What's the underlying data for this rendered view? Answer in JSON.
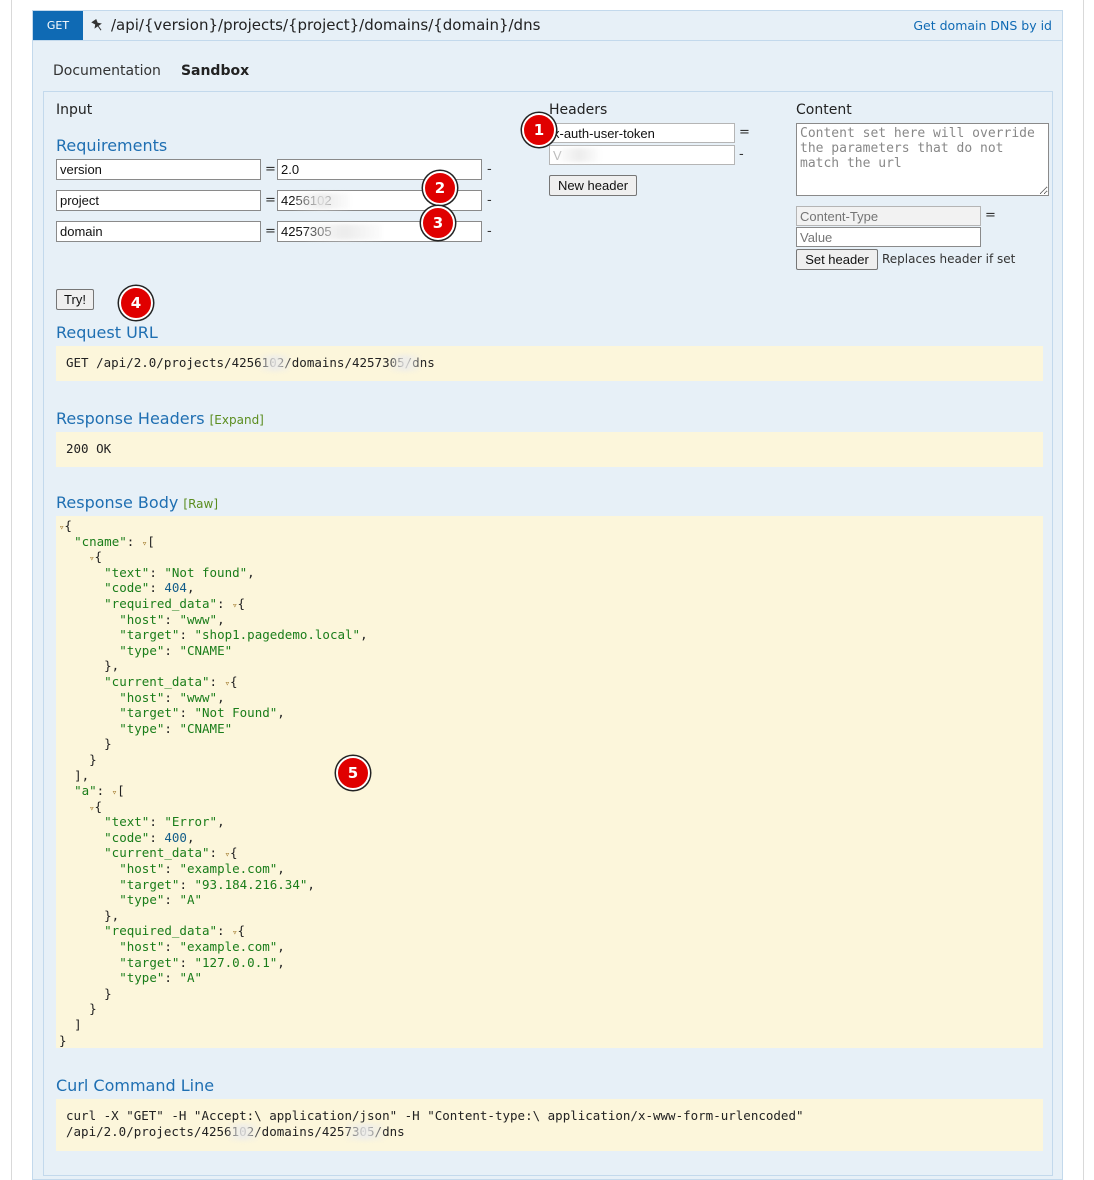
{
  "endpoint": {
    "method": "GET",
    "path": "/api/{version}/projects/{project}/domains/{domain}/dns",
    "summary": "Get domain DNS by id",
    "pin_icon": "pin-icon"
  },
  "tabs": [
    {
      "label": "Documentation",
      "active": false
    },
    {
      "label": "Sandbox",
      "active": true
    }
  ],
  "input": {
    "title": "Input",
    "requirements_title": "Requirements",
    "params": [
      {
        "name": "version",
        "value": "2.0"
      },
      {
        "name": "project",
        "value": "4256102"
      },
      {
        "name": "domain",
        "value": "4257305"
      }
    ],
    "try_label": "Try!"
  },
  "headers": {
    "title": "Headers",
    "name_value": "x-auth-user-token",
    "value_value": "V",
    "new_header_label": "New header"
  },
  "content": {
    "title": "Content",
    "placeholder": "Content set here will override the parameters that do not match the url",
    "content_type_placeholder": "Content-Type",
    "value_placeholder": "Value",
    "set_header_label": "Set header",
    "replaces_note": "Replaces header if set"
  },
  "request_url": {
    "title": "Request URL",
    "text": "GET /api/2.0/projects/4256102/domains/4257305/dns"
  },
  "response_headers": {
    "title": "Response Headers",
    "expand_label": "[Expand]",
    "text": "200 OK"
  },
  "response_body": {
    "title": "Response Body",
    "raw_label": "[Raw]",
    "lines": [
      {
        "indent": 0,
        "parts": [
          [
            "t",
            "▿"
          ],
          [
            "p",
            "{"
          ]
        ]
      },
      {
        "indent": 1,
        "parts": [
          [
            "k",
            "\"cname\""
          ],
          [
            "p",
            ": "
          ],
          [
            "t",
            "▿"
          ],
          [
            "p",
            "["
          ]
        ]
      },
      {
        "indent": 2,
        "parts": [
          [
            "t",
            "▿"
          ],
          [
            "p",
            "{"
          ]
        ]
      },
      {
        "indent": 3,
        "parts": [
          [
            "k",
            "\"text\""
          ],
          [
            "p",
            ": "
          ],
          [
            "s",
            "\"Not found\""
          ],
          [
            "p",
            ","
          ]
        ]
      },
      {
        "indent": 3,
        "parts": [
          [
            "k",
            "\"code\""
          ],
          [
            "p",
            ": "
          ],
          [
            "n",
            "404"
          ],
          [
            "p",
            ","
          ]
        ]
      },
      {
        "indent": 3,
        "parts": [
          [
            "k",
            "\"required_data\""
          ],
          [
            "p",
            ": "
          ],
          [
            "t",
            "▿"
          ],
          [
            "p",
            "{"
          ]
        ]
      },
      {
        "indent": 4,
        "parts": [
          [
            "k",
            "\"host\""
          ],
          [
            "p",
            ": "
          ],
          [
            "s",
            "\"www\""
          ],
          [
            "p",
            ","
          ]
        ]
      },
      {
        "indent": 4,
        "parts": [
          [
            "k",
            "\"target\""
          ],
          [
            "p",
            ": "
          ],
          [
            "s",
            "\"shop1.pagedemo.local\""
          ],
          [
            "p",
            ","
          ]
        ]
      },
      {
        "indent": 4,
        "parts": [
          [
            "k",
            "\"type\""
          ],
          [
            "p",
            ": "
          ],
          [
            "s",
            "\"CNAME\""
          ]
        ]
      },
      {
        "indent": 3,
        "parts": [
          [
            "p",
            "},"
          ]
        ]
      },
      {
        "indent": 3,
        "parts": [
          [
            "k",
            "\"current_data\""
          ],
          [
            "p",
            ": "
          ],
          [
            "t",
            "▿"
          ],
          [
            "p",
            "{"
          ]
        ]
      },
      {
        "indent": 4,
        "parts": [
          [
            "k",
            "\"host\""
          ],
          [
            "p",
            ": "
          ],
          [
            "s",
            "\"www\""
          ],
          [
            "p",
            ","
          ]
        ]
      },
      {
        "indent": 4,
        "parts": [
          [
            "k",
            "\"target\""
          ],
          [
            "p",
            ": "
          ],
          [
            "s",
            "\"Not Found\""
          ],
          [
            "p",
            ","
          ]
        ]
      },
      {
        "indent": 4,
        "parts": [
          [
            "k",
            "\"type\""
          ],
          [
            "p",
            ": "
          ],
          [
            "s",
            "\"CNAME\""
          ]
        ]
      },
      {
        "indent": 3,
        "parts": [
          [
            "p",
            "}"
          ]
        ]
      },
      {
        "indent": 2,
        "parts": [
          [
            "p",
            "}"
          ]
        ]
      },
      {
        "indent": 1,
        "parts": [
          [
            "p",
            "],"
          ]
        ]
      },
      {
        "indent": 1,
        "parts": [
          [
            "k",
            "\"a\""
          ],
          [
            "p",
            ": "
          ],
          [
            "t",
            "▿"
          ],
          [
            "p",
            "["
          ]
        ]
      },
      {
        "indent": 2,
        "parts": [
          [
            "t",
            "▿"
          ],
          [
            "p",
            "{"
          ]
        ]
      },
      {
        "indent": 3,
        "parts": [
          [
            "k",
            "\"text\""
          ],
          [
            "p",
            ": "
          ],
          [
            "s",
            "\"Error\""
          ],
          [
            "p",
            ","
          ]
        ]
      },
      {
        "indent": 3,
        "parts": [
          [
            "k",
            "\"code\""
          ],
          [
            "p",
            ": "
          ],
          [
            "n",
            "400"
          ],
          [
            "p",
            ","
          ]
        ]
      },
      {
        "indent": 3,
        "parts": [
          [
            "k",
            "\"current_data\""
          ],
          [
            "p",
            ": "
          ],
          [
            "t",
            "▿"
          ],
          [
            "p",
            "{"
          ]
        ]
      },
      {
        "indent": 4,
        "parts": [
          [
            "k",
            "\"host\""
          ],
          [
            "p",
            ": "
          ],
          [
            "s",
            "\"example.com\""
          ],
          [
            "p",
            ","
          ]
        ]
      },
      {
        "indent": 4,
        "parts": [
          [
            "k",
            "\"target\""
          ],
          [
            "p",
            ": "
          ],
          [
            "s",
            "\"93.184.216.34\""
          ],
          [
            "p",
            ","
          ]
        ]
      },
      {
        "indent": 4,
        "parts": [
          [
            "k",
            "\"type\""
          ],
          [
            "p",
            ": "
          ],
          [
            "s",
            "\"A\""
          ]
        ]
      },
      {
        "indent": 3,
        "parts": [
          [
            "p",
            "},"
          ]
        ]
      },
      {
        "indent": 3,
        "parts": [
          [
            "k",
            "\"required_data\""
          ],
          [
            "p",
            ": "
          ],
          [
            "t",
            "▿"
          ],
          [
            "p",
            "{"
          ]
        ]
      },
      {
        "indent": 4,
        "parts": [
          [
            "k",
            "\"host\""
          ],
          [
            "p",
            ": "
          ],
          [
            "s",
            "\"example.com\""
          ],
          [
            "p",
            ","
          ]
        ]
      },
      {
        "indent": 4,
        "parts": [
          [
            "k",
            "\"target\""
          ],
          [
            "p",
            ": "
          ],
          [
            "s",
            "\"127.0.0.1\""
          ],
          [
            "p",
            ","
          ]
        ]
      },
      {
        "indent": 4,
        "parts": [
          [
            "k",
            "\"type\""
          ],
          [
            "p",
            ": "
          ],
          [
            "s",
            "\"A\""
          ]
        ]
      },
      {
        "indent": 3,
        "parts": [
          [
            "p",
            "}"
          ]
        ]
      },
      {
        "indent": 2,
        "parts": [
          [
            "p",
            "}"
          ]
        ]
      },
      {
        "indent": 1,
        "parts": [
          [
            "p",
            "]"
          ]
        ]
      },
      {
        "indent": 0,
        "parts": [
          [
            "p",
            "}"
          ]
        ]
      }
    ]
  },
  "curl": {
    "title": "Curl Command Line",
    "line1": "curl -X \"GET\" -H \"Accept:\\ application/json\" -H \"Content-type:\\ application/x-www-form-urlencoded\"",
    "line2": "/api/2.0/projects/4256102/domains/4257305/dns"
  },
  "markers": [
    "1",
    "2",
    "3",
    "4",
    "5"
  ],
  "colors": {
    "method_badge": "#0f6ab4",
    "section_title": "#1f6fb2",
    "code_background": "#fcf6db",
    "panel_background": "#e7f0f7",
    "marker": "#e00000"
  }
}
